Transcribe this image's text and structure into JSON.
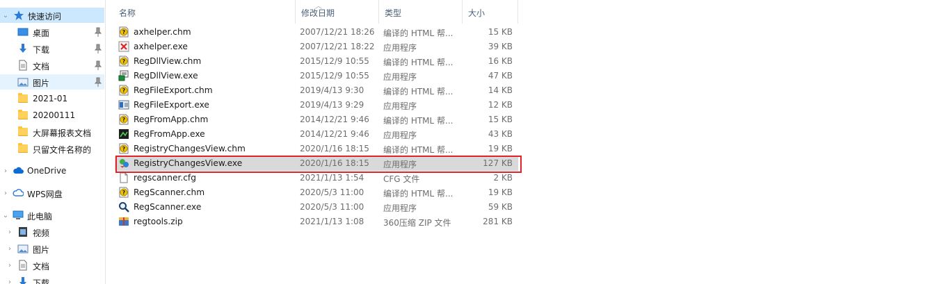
{
  "nav": {
    "quick_access": "快速访问",
    "items": [
      {
        "label": "桌面",
        "icon": "desktop-icon"
      },
      {
        "label": "下载",
        "icon": "download-icon"
      },
      {
        "label": "文档",
        "icon": "document-icon"
      },
      {
        "label": "图片",
        "icon": "pictures-icon"
      },
      {
        "label": "2021-01",
        "icon": "folder-icon"
      },
      {
        "label": "20200111",
        "icon": "folder-icon"
      },
      {
        "label": "大屏幕报表文档",
        "icon": "folder-icon"
      },
      {
        "label": "只留文件名称的",
        "icon": "folder-icon"
      }
    ],
    "onedrive": "OneDrive",
    "wps": "WPS网盘",
    "this_pc": "此电脑",
    "pc_items": [
      {
        "label": "视频",
        "icon": "video-icon"
      },
      {
        "label": "图片",
        "icon": "pictures-icon"
      },
      {
        "label": "文档",
        "icon": "document-icon"
      },
      {
        "label": "下载",
        "icon": "download-icon"
      }
    ]
  },
  "columns": {
    "name": "名称",
    "date": "修改日期",
    "type": "类型",
    "size": "大小"
  },
  "files": [
    {
      "name": "axhelper.chm",
      "date": "2007/12/21 18:26",
      "type": "编译的 HTML 帮...",
      "size": "15 KB",
      "icon": "chm-help-icon"
    },
    {
      "name": "axhelper.exe",
      "date": "2007/12/21 18:22",
      "type": "应用程序",
      "size": "39 KB",
      "icon": "axhelper-app-icon"
    },
    {
      "name": "RegDllView.chm",
      "date": "2015/12/9 10:55",
      "type": "编译的 HTML 帮...",
      "size": "16 KB",
      "icon": "chm-help-icon"
    },
    {
      "name": "RegDllView.exe",
      "date": "2015/12/9 10:55",
      "type": "应用程序",
      "size": "47 KB",
      "icon": "regdllview-app-icon"
    },
    {
      "name": "RegFileExport.chm",
      "date": "2019/4/13 9:30",
      "type": "编译的 HTML 帮...",
      "size": "14 KB",
      "icon": "chm-help-icon"
    },
    {
      "name": "RegFileExport.exe",
      "date": "2019/4/13 9:29",
      "type": "应用程序",
      "size": "12 KB",
      "icon": "regfileexport-app-icon"
    },
    {
      "name": "RegFromApp.chm",
      "date": "2014/12/21 9:46",
      "type": "编译的 HTML 帮...",
      "size": "15 KB",
      "icon": "chm-help-icon"
    },
    {
      "name": "RegFromApp.exe",
      "date": "2014/12/21 9:46",
      "type": "应用程序",
      "size": "43 KB",
      "icon": "regfromapp-app-icon"
    },
    {
      "name": "RegistryChangesView.chm",
      "date": "2020/1/16 18:15",
      "type": "编译的 HTML 帮...",
      "size": "19 KB",
      "icon": "chm-help-icon"
    },
    {
      "name": "RegistryChangesView.exe",
      "date": "2020/1/16 18:15",
      "type": "应用程序",
      "size": "127 KB",
      "icon": "registrychangesview-app-icon",
      "selected": true
    },
    {
      "name": "regscanner.cfg",
      "date": "2021/1/13 1:54",
      "type": "CFG 文件",
      "size": "2 KB",
      "icon": "cfg-file-icon"
    },
    {
      "name": "RegScanner.chm",
      "date": "2020/5/3 11:00",
      "type": "编译的 HTML 帮...",
      "size": "19 KB",
      "icon": "chm-help-icon"
    },
    {
      "name": "RegScanner.exe",
      "date": "2020/5/3 11:00",
      "type": "应用程序",
      "size": "59 KB",
      "icon": "regscanner-app-icon"
    },
    {
      "name": "regtools.zip",
      "date": "2021/1/13 1:08",
      "type": "360压缩 ZIP 文件",
      "size": "281 KB",
      "icon": "zip-archive-icon"
    }
  ],
  "colors": {
    "selection": "#cce8ff",
    "row_selected": "#d9d9d9",
    "highlight_border": "#e0232b"
  }
}
